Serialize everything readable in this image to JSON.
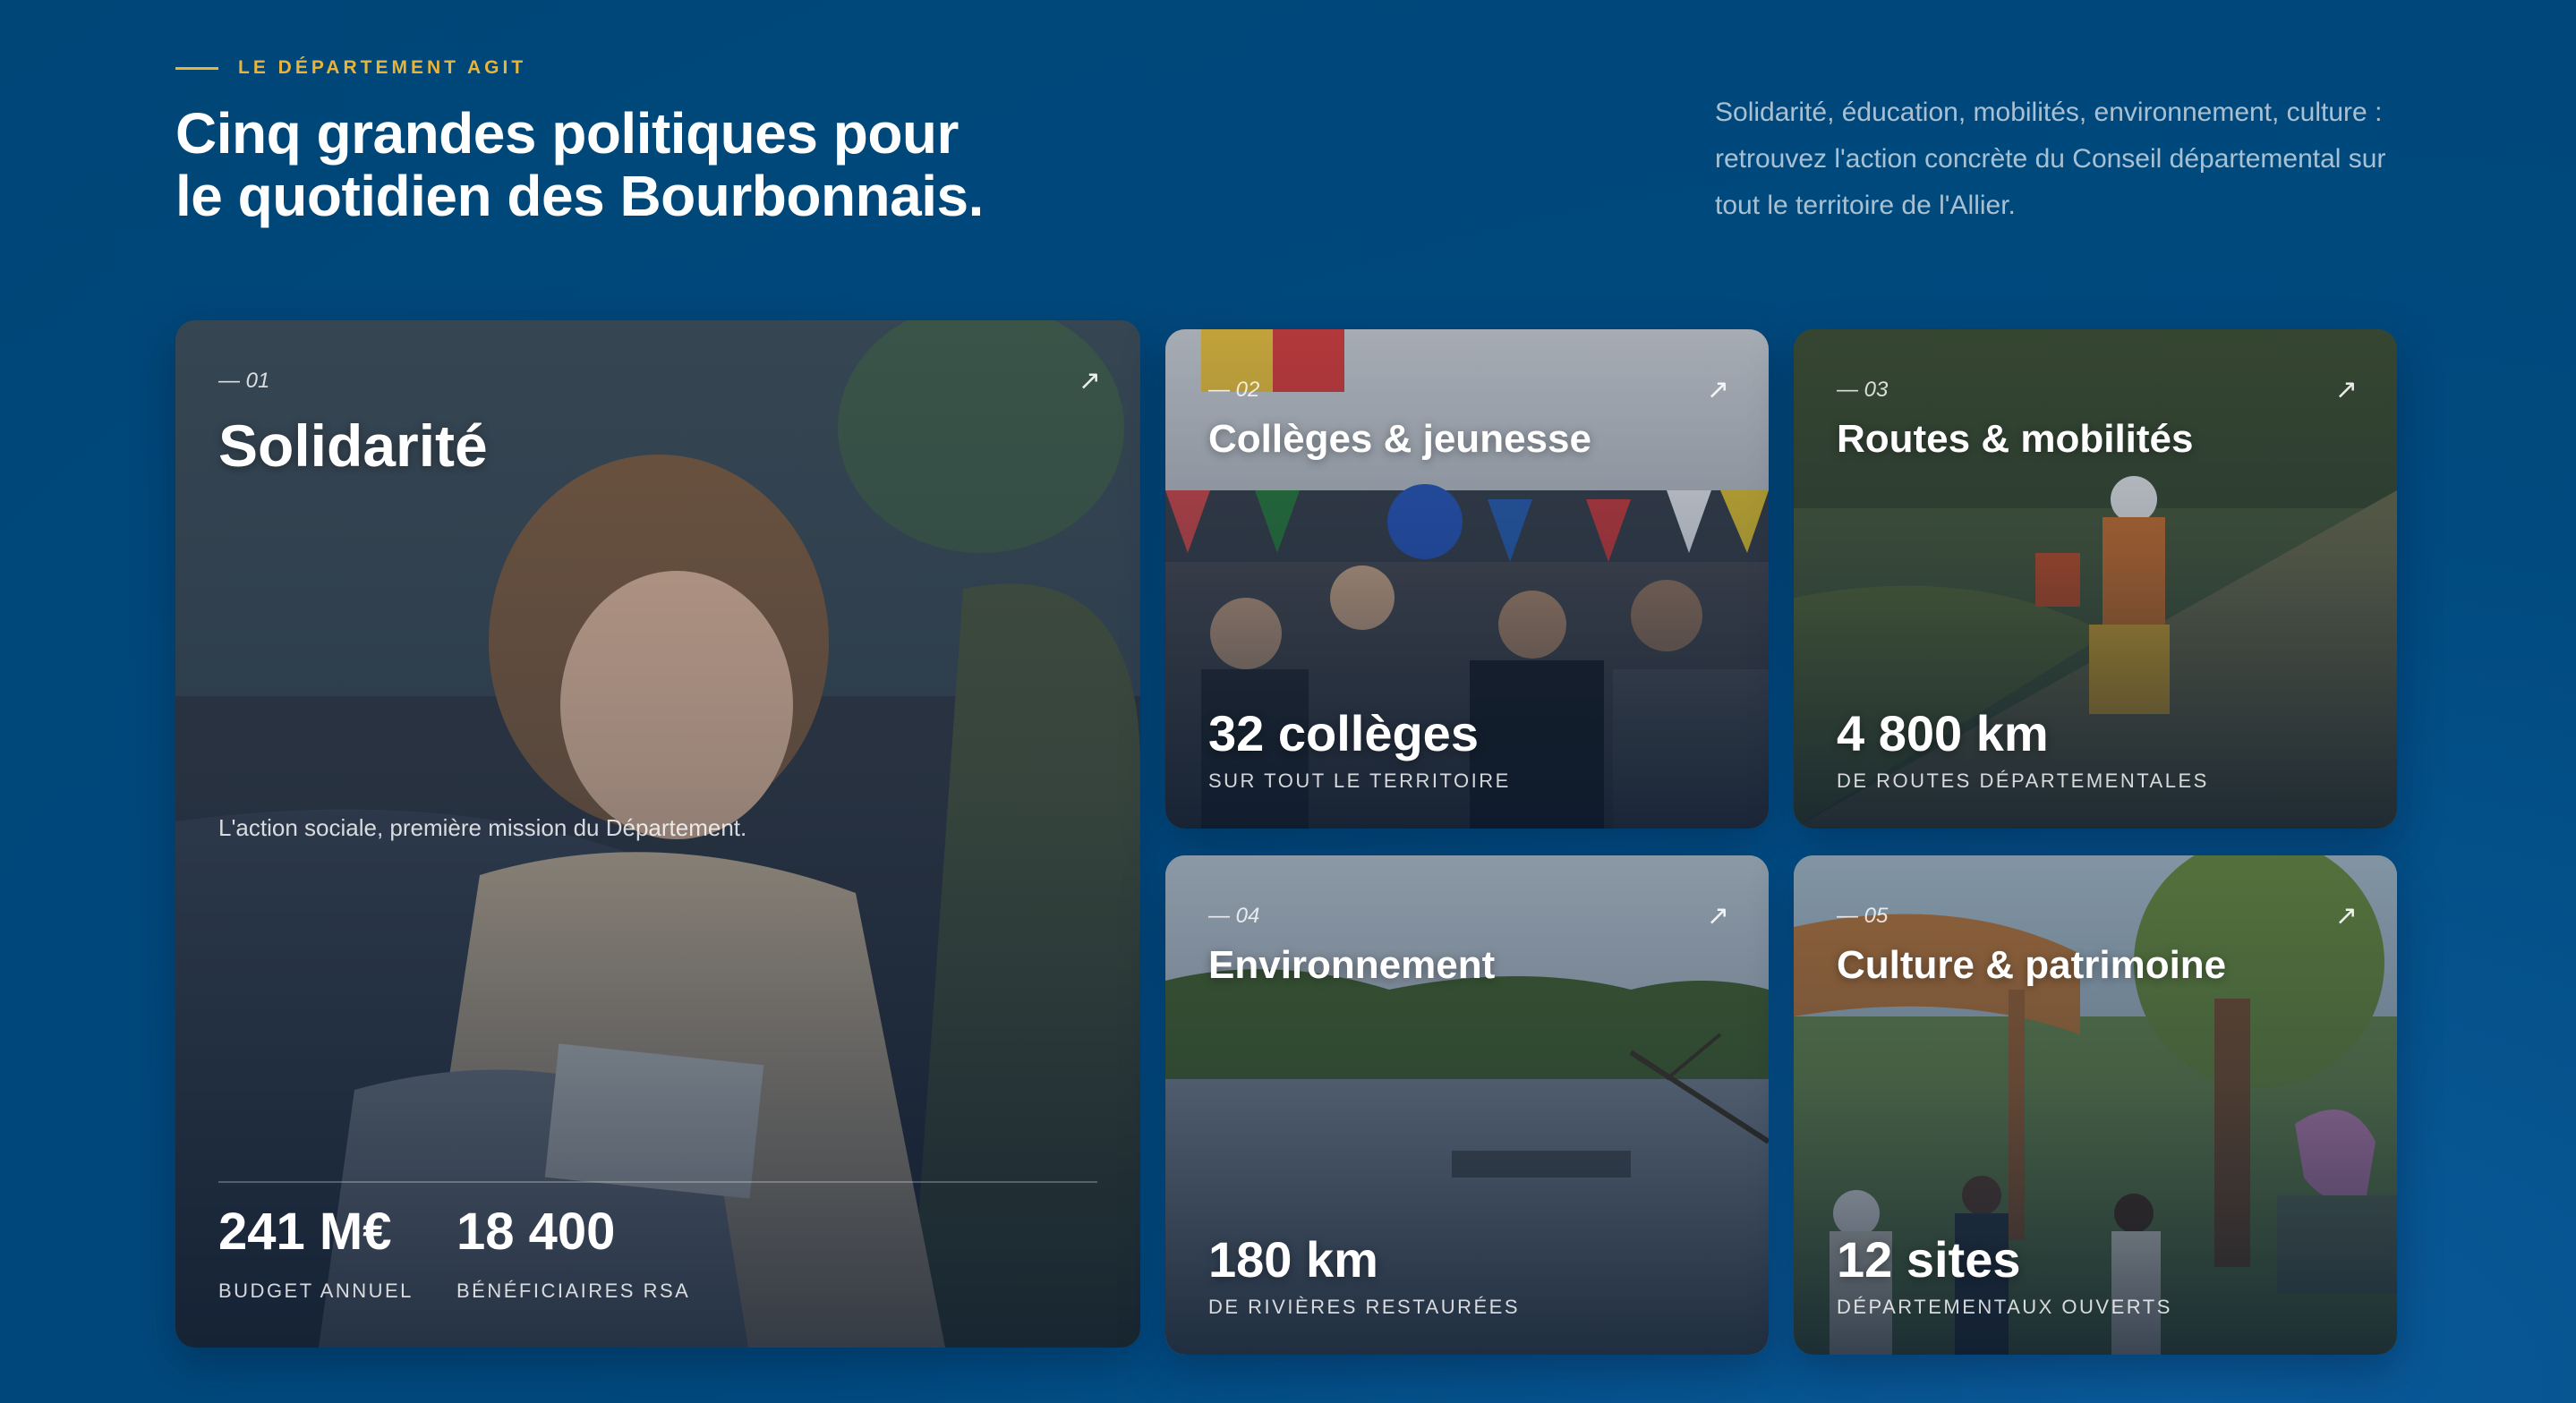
{
  "header": {
    "eyebrow": "LE DÉPARTEMENT AGIT",
    "title_line1": "Cinq grandes politiques pour",
    "title_line2": "le quotidien des Bourbonnais.",
    "intro": "Solidarité, éducation, mobilités, environnement, culture : retrouvez l'action concrète du Conseil départemental sur tout le territoire de l'Allier."
  },
  "cards": [
    {
      "num": "— 01",
      "title": "Solidarité",
      "subtitle": "L'action sociale, première mission du Département.",
      "arrow": "↗",
      "stats": [
        {
          "value": "241 M€",
          "label": "BUDGET ANNUEL"
        },
        {
          "value": "18 400",
          "label": "BÉNÉFICIAIRES RSA"
        }
      ]
    },
    {
      "num": "— 02",
      "title": "Collèges & jeunesse",
      "arrow": "↗",
      "stat": "32 collèges",
      "stat_label": "SUR TOUT LE TERRITOIRE"
    },
    {
      "num": "— 03",
      "title": "Routes & mobilités",
      "arrow": "↗",
      "stat": "4 800 km",
      "stat_label": "DE ROUTES DÉPARTEMENTALES"
    },
    {
      "num": "— 04",
      "title": "Environnement",
      "arrow": "↗",
      "stat": "180 km",
      "stat_label": "DE RIVIÈRES RESTAURÉES"
    },
    {
      "num": "— 05",
      "title": "Culture & patrimoine",
      "arrow": "↗",
      "stat": "12 sites",
      "stat_label": "DÉPARTEMENTAUX OUVERTS"
    }
  ],
  "colors": {
    "background": "#004a7f",
    "accent": "#e9b43a"
  }
}
